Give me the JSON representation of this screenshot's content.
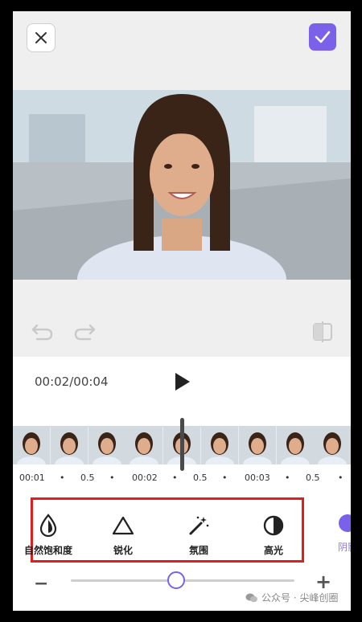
{
  "header": {
    "close_icon": "close-icon",
    "confirm_icon": "check-icon",
    "accent_color": "#7b61e9"
  },
  "player": {
    "time": "00:02/00:04",
    "play_icon": "play-icon"
  },
  "timeline": {
    "ticks": [
      "00:01",
      "•",
      "0.5",
      "•",
      "00:02",
      "•",
      "0.5",
      "•",
      "00:03",
      "•",
      "0.5",
      "•"
    ]
  },
  "tools": [
    {
      "label": "自然饱和度",
      "icon": "droplet-icon"
    },
    {
      "label": "锐化",
      "icon": "triangle-icon"
    },
    {
      "label": "氛围",
      "icon": "magic-wand-icon"
    },
    {
      "label": "高光",
      "icon": "half-circle-icon"
    },
    {
      "label": "阴影",
      "icon": "circle-icon"
    }
  ],
  "slider": {
    "minus": "−",
    "plus": "+",
    "value_fraction": 0.5
  },
  "watermark": "公众号 · 尖峰创圈"
}
